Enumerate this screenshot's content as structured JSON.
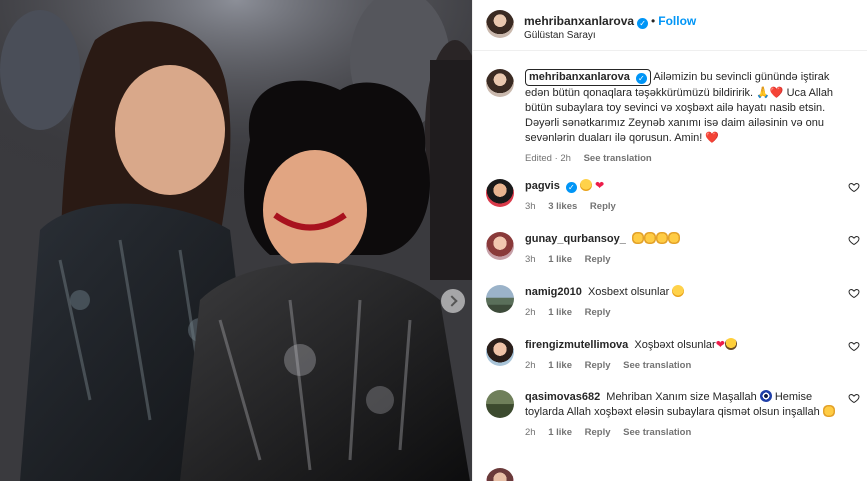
{
  "header": {
    "username": "mehribanxanlarova",
    "separator": "•",
    "follow_label": "Follow",
    "location": "Gülüstan Sarayı"
  },
  "caption": {
    "username": "mehribanxanlarova",
    "text": "Ailəmizin bu sevincli günündə iştirak edən bütün qonaqlara təşəkkürümüzü bildiririk. 🙏❤️ Uca Allah bütün subaylara toy sevinci və xoşbəxt ailə hayatı nasib etsin. Dəyərli sənətkarımız Zeynəb xanımı isə daim ailəsinin və onu sevənlərin duaları ilə qorusun. Amin! ❤️",
    "edited": "Edited · 2h",
    "see_translation": "See translation"
  },
  "comments": [
    {
      "username": "pagvis",
      "text": "",
      "time": "3h",
      "likes": "3 likes",
      "reply": "Reply",
      "emoji": [
        "smile",
        "heart"
      ],
      "verified": true
    },
    {
      "username": "gunay_qurbansoy_",
      "text": "",
      "time": "3h",
      "likes": "1 like",
      "reply": "Reply",
      "emoji": [
        "clap",
        "clap",
        "clap",
        "clap"
      ]
    },
    {
      "username": "namig2010",
      "text": "Xosbext olsunlar",
      "time": "2h",
      "likes": "1 like",
      "reply": "Reply",
      "emoji": [
        "smile"
      ]
    },
    {
      "username": "firengizmutellimova",
      "text": "Xoşbəxt olsunlar",
      "time": "2h",
      "likes": "1 like",
      "reply": "Reply",
      "see_translation": "See translation",
      "emoji": [
        "heart",
        "hug"
      ]
    },
    {
      "username": "qasimovas682",
      "text": "Mehriban Xanım size Maşallah",
      "text2": "Hemise toylarda Allah xoşbəxt eləsin subaylara qismət olsun inşallah",
      "time": "2h",
      "likes": "1 like",
      "reply": "Reply",
      "see_translation": "See translation"
    }
  ],
  "colors": {
    "accent": "#0095f6",
    "text": "#262626",
    "muted": "#737373",
    "heart": "#ed1c4a"
  },
  "icons": {
    "verified": "verified-badge-icon",
    "like": "heart-outline-icon",
    "next": "chevron-right-icon"
  }
}
